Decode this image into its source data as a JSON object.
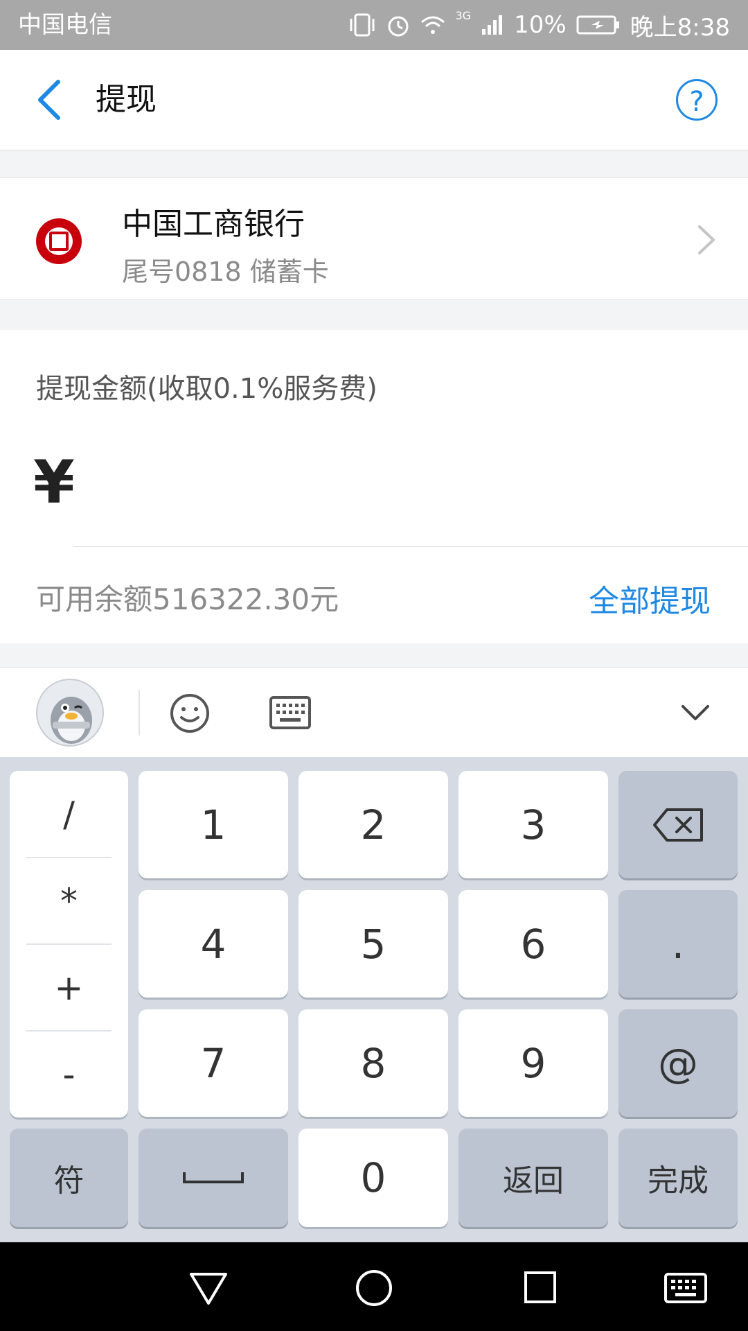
{
  "status_bar": {
    "carrier": "中国电信",
    "battery": "10%",
    "time": "晚上8:38",
    "network": "3G"
  },
  "header": {
    "title": "提现",
    "back_icon": "back-arrow-icon",
    "help_label": "?"
  },
  "bank": {
    "name": "中国工商银行",
    "card_info": "尾号0818 储蓄卡"
  },
  "amount": {
    "label": "提现金额(收取0.1%服务费)",
    "currency_symbol": "¥",
    "value": "",
    "balance_text": "可用余额516322.30元",
    "withdraw_all_label": "全部提现"
  },
  "keyboard": {
    "symbols": [
      "/",
      "*",
      "+",
      "-"
    ],
    "digits": [
      "1",
      "2",
      "3",
      "4",
      "5",
      "6",
      "7",
      "8",
      "9",
      "0"
    ],
    "dot": ".",
    "at": "@",
    "sym_label": "符",
    "back_label": "返回",
    "done_label": "完成"
  },
  "colors": {
    "accent": "#1e88e5",
    "bank_red": "#c7000b",
    "status_bar": "#a8a8a8",
    "keyboard_bg": "#d6dbe3"
  }
}
